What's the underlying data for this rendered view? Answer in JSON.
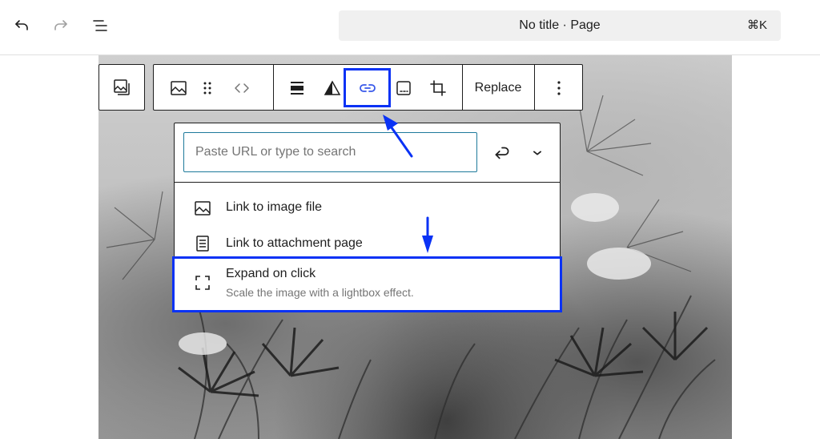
{
  "topbar": {
    "undo_icon": "undo-icon",
    "redo_icon": "redo-icon",
    "list_view_icon": "list-view-icon",
    "command_title": "No title · Page",
    "command_shortcut": "⌘K"
  },
  "block_toolbar": {
    "block_type_icon": "image-block-icon",
    "buttons": [
      "image-icon",
      "drag-handle-icon",
      "move-arrows-icon",
      "align-icon",
      "duotone-icon",
      "link-icon",
      "caption-icon",
      "crop-icon"
    ],
    "replace_label": "Replace",
    "more_icon": "more-vertical-icon"
  },
  "link_popover": {
    "search": {
      "placeholder": "Paste URL or type to search",
      "value": ""
    },
    "options": [
      {
        "label": "Link to image file",
        "icon": "image-icon"
      },
      {
        "label": "Link to attachment page",
        "icon": "page-icon"
      },
      {
        "label": "Expand on click",
        "description": "Scale the image with a lightbox effect.",
        "icon": "fullscreen-icon"
      }
    ]
  },
  "colors": {
    "annotation": "#0a32f5",
    "link_active": "#3858e9",
    "input_border": "#1e7a9b",
    "text": "#1e1e1e",
    "muted": "#757575"
  }
}
